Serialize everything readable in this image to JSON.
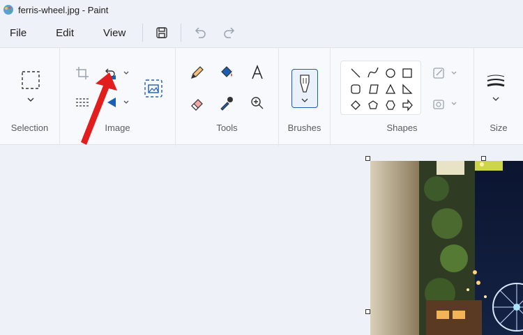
{
  "window": {
    "title": "ferris-wheel.jpg - Paint"
  },
  "menu": {
    "file": "File",
    "edit": "Edit",
    "view": "View"
  },
  "ribbon": {
    "groups": {
      "selection": "Selection",
      "image": "Image",
      "tools": "Tools",
      "brushes": "Brushes",
      "shapes": "Shapes",
      "size": "Size"
    }
  },
  "icons": {
    "app": "paint-app-icon",
    "save": "save-icon",
    "undo": "undo-icon",
    "redo": "redo-icon",
    "selection": "rectangle-select-icon",
    "crop": "crop-icon",
    "rotate": "rotate-icon",
    "resize": "resize-icon",
    "flip": "flip-icon",
    "image_creator": "image-creator-icon",
    "pencil": "pencil-icon",
    "fill": "fill-bucket-icon",
    "text": "text-icon",
    "eraser": "eraser-icon",
    "color_picker": "color-picker-icon",
    "magnifier": "magnifier-icon",
    "brush": "brush-icon",
    "size": "line-size-icon",
    "annotation": "red-arrow-pointer"
  },
  "colors": {
    "accent": "#1a5fb4",
    "arrow": "#e11d1d",
    "background": "#eef2f8",
    "ribbon": "#f7f9fc"
  }
}
